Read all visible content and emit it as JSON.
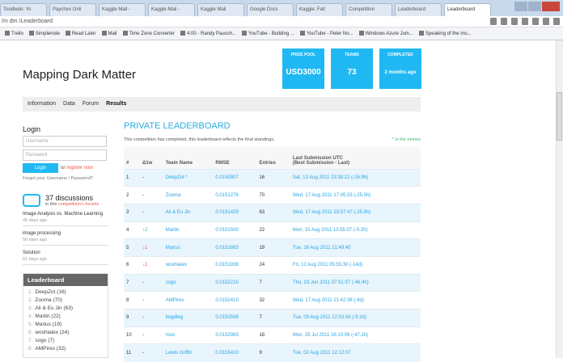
{
  "browser": {
    "tabs": [
      "Toodledo: Yo",
      "Paychex Onli",
      "Kaggle Mail -",
      "Kaggle Mail -",
      "Kaggle Mail",
      "Google Docs",
      "Kaggle: Fall",
      "Competition",
      "Leaderboard",
      "Leaderboard"
    ],
    "address": "/m dm /Leaderboard",
    "bookmarks": [
      "Trello",
      "Simplenote",
      "Read Later",
      "Mail",
      "Time Zone Converter",
      "4:00 - Randy Pausch...",
      "YouTube - Building ...",
      "YouTube - Peter No...",
      "Windows Azure Jum...",
      "Speaking of the mo..."
    ]
  },
  "title": "Mapping Dark Matter",
  "stats": [
    {
      "label": "PRIZE POOL",
      "value": "USD3000"
    },
    {
      "label": "TEAMS",
      "value": "73"
    },
    {
      "label": "COMPLETED",
      "value": "2 months ago"
    }
  ],
  "nav": [
    "Information",
    "Data",
    "Forum",
    "Results"
  ],
  "login": {
    "heading": "Login",
    "username_ph": "Username",
    "password_ph": "Password",
    "button": "Login",
    "or": "or",
    "register": "register now",
    "forgot": "Forgot your Username / Password?"
  },
  "discussions": {
    "count": "37 discussions",
    "sub_prefix": "in this",
    "sub_link": "competition's forums",
    "items": [
      {
        "title": "Image Analysis vs. Machine Learning",
        "age": "49 days ago"
      },
      {
        "title": "image processing",
        "age": "50 days ago"
      },
      {
        "title": "Solution",
        "age": "61 days ago"
      }
    ]
  },
  "sidebar_leaderboard": {
    "heading": "Leaderboard",
    "items": [
      "DeepZot (16)",
      "Zoomа (70)",
      "Ali & Eu Jin (63)",
      "Martin (22)",
      "Marius (19)",
      "woshialex (24)",
      "sogo (7)",
      "AMPires (32)"
    ]
  },
  "leaderboard": {
    "heading": "PRIVATE LEADERBOARD",
    "description": "This competition has completed, this leaderboard reflects the final standings.",
    "money_note": "* in the money",
    "columns": [
      "#",
      "Δ1w",
      "Team Name",
      "RMSE",
      "Entries",
      "Last Submission UTC",
      "(Best Submission - Last)"
    ],
    "rows": [
      [
        "1",
        "-",
        "DeepZot *",
        "0.0150907",
        "16",
        "Sat, 13 Aug 2011 23:38:22 (-26.9h)"
      ],
      [
        "2",
        "-",
        "Zoomа",
        "0.0151276",
        "70",
        "Wed, 17 Aug 2011 17:05:33 (-25.5h)"
      ],
      [
        "3",
        "-",
        "Ali & Eu Jin",
        "0.0151429",
        "63",
        "Wed, 17 Aug 2011 23:57:47 (-25.9h)"
      ],
      [
        "4",
        "↑2",
        "Martin",
        "0.0151500",
        "22",
        "Mon, 15 Aug 2011 13:55:07 (-0.2h)"
      ],
      [
        "5",
        "↓1",
        "Marius",
        "0.0151883",
        "19",
        "Tue, 16 Aug 2011 21:49:40"
      ],
      [
        "6",
        "↓1",
        "woshialex",
        "0.0151938",
        "24",
        "Fri, 12 Aug 2011 05:55:30 (-14d)"
      ],
      [
        "7",
        "-",
        "sogo",
        "0.0152215",
        "7",
        "Thu, 23 Jun 2011 07:51:37 (-46.4h)"
      ],
      [
        "8",
        "-",
        "AMPires",
        "0.0152410",
        "32",
        "Wed, 17 Aug 2011 21:42:38 (-6d)"
      ],
      [
        "9",
        "-",
        "bogdleg",
        "0.0152598",
        "7",
        "Tue, 09 Aug 2011 12:53:43 (-9.2d)"
      ],
      [
        "10",
        "-",
        "moo",
        "0.0152983",
        "18",
        "Mon, 25 Jul 2011 16:10:09 (-47.1h)"
      ],
      [
        "11",
        "-",
        "Lewis Griffin",
        "0.0153410",
        "9",
        "Tue, 02 Aug 2011 12:12:07"
      ]
    ]
  }
}
